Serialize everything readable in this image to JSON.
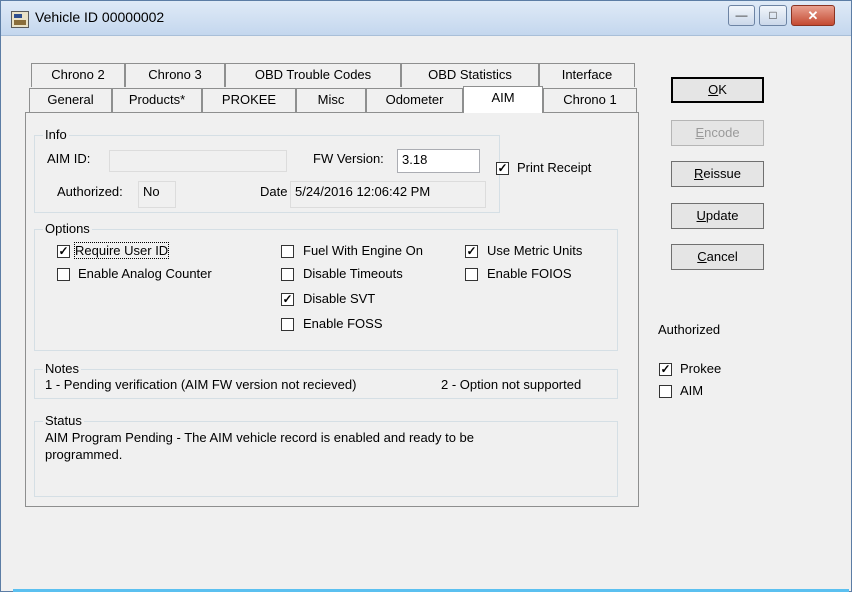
{
  "window": {
    "title": "Vehicle ID 00000002"
  },
  "tabs_row1": [
    "Chrono 2",
    "Chrono 3",
    "OBD Trouble Codes",
    "OBD Statistics",
    "Interface"
  ],
  "tabs_row2": [
    "General",
    "Products*",
    "PROKEE",
    "Misc",
    "Odometer",
    "AIM",
    "Chrono 1"
  ],
  "active_tab": "AIM",
  "info": {
    "group_label": "Info",
    "aim_id_label": "AIM ID:",
    "aim_id_value": "",
    "fw_version_label": "FW Version:",
    "fw_version_value": "3.18",
    "authorized_label": "Authorized:",
    "authorized_value": "No",
    "date_label": "Date",
    "date_value": "5/24/2016 12:06:42 PM",
    "print_receipt_label": "Print Receipt",
    "print_receipt_checked": true
  },
  "options": {
    "group_label": "Options",
    "items": [
      {
        "label": "Require User ID",
        "checked": true
      },
      {
        "label": "Enable Analog Counter",
        "checked": false
      },
      {
        "label": "Fuel With Engine On",
        "checked": false
      },
      {
        "label": "Disable Timeouts",
        "checked": false
      },
      {
        "label": "Disable SVT",
        "checked": true
      },
      {
        "label": "Enable FOSS",
        "checked": false
      },
      {
        "label": "Use Metric Units",
        "checked": true
      },
      {
        "label": "Enable FOIOS",
        "checked": false
      }
    ]
  },
  "notes": {
    "group_label": "Notes",
    "note1": "1 - Pending verification (AIM FW version not recieved)",
    "note2": "2 - Option not supported"
  },
  "status": {
    "group_label": "Status",
    "text_line1": "AIM Program Pending - The AIM vehicle record is enabled and ready to be",
    "text_line2": "programmed."
  },
  "buttons": {
    "ok": {
      "accel": "O",
      "rest": "K"
    },
    "encode": {
      "accel": "E",
      "rest": "ncode"
    },
    "reissue": {
      "accel": "R",
      "rest": "eissue"
    },
    "update": {
      "accel": "U",
      "rest": "pdate"
    },
    "cancel": {
      "accel": "C",
      "rest": "ancel"
    }
  },
  "authorized_panel": {
    "heading": "Authorized",
    "prokee_label": "Prokee",
    "prokee_checked": true,
    "aim_label": "AIM",
    "aim_checked": false
  },
  "icons": {
    "app": "vehicle-app-icon",
    "minimize": "minimize-icon",
    "maximize": "maximize-icon",
    "close": "close-icon"
  }
}
